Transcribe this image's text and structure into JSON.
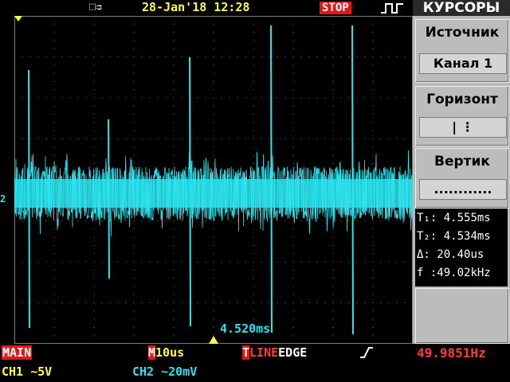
{
  "topbar": {
    "usb_icon": "usb-connector-icon",
    "datetime": "28-Jan'18 12:28",
    "run_state": "STOP",
    "trigger_icon": "trigger-waveform-icon"
  },
  "side_menu": {
    "header": "КУРСОРЫ",
    "source": {
      "title": "Источник",
      "value": "Канал 1"
    },
    "horizontal": {
      "title": "Горизонт",
      "value": "| ⋮"
    },
    "vertical": {
      "title": "Вертик",
      "value": "............"
    },
    "readouts": [
      {
        "label": "T₁:",
        "value": "4.555ms"
      },
      {
        "label": "T₂:",
        "value": "4.534ms"
      },
      {
        "label": "Δ:",
        "value": "20.40us"
      },
      {
        "label": "f :",
        "value": "49.02kHz"
      }
    ]
  },
  "scope": {
    "ch2_marker": "2",
    "cursor_time": "4.520ms",
    "trace_color": "#2de2ec",
    "grid_color": "#7a7a7a"
  },
  "status": {
    "main_label": "MAIN",
    "m_label": "M",
    "timebase": "10us",
    "t_label": "T",
    "trig_source": "LINE",
    "trig_mode": "EDGE",
    "edge_icon": "rising-edge-icon",
    "frequency": "49.9851Hz",
    "ch1": "CH1 ∼5V",
    "ch2": "CH2 ∼20mV"
  }
}
